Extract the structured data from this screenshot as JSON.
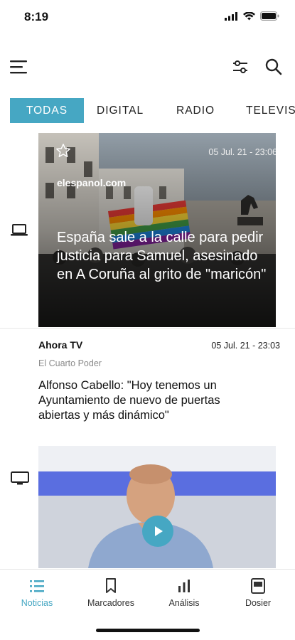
{
  "status_bar": {
    "time": "8:19"
  },
  "tabs": [
    {
      "label": "TODAS",
      "active": true
    },
    {
      "label": "DIGITAL",
      "active": false
    },
    {
      "label": "RADIO",
      "active": false
    },
    {
      "label": "TELEVIS",
      "active": false
    }
  ],
  "feed": [
    {
      "device": "laptop-icon",
      "date": "05 Jul. 21 - 23:06",
      "source": "elespanol.com",
      "headline": "España sale a la calle para pedir justicia para Samuel, asesinado en A Coruña al grito de \"maricón\""
    },
    {
      "device": "laptop-icon",
      "source": "Ahora TV",
      "date": "05 Jul. 21 - 23:03",
      "program": "El Cuarto Poder",
      "title": "Alfonso Cabello: \"Hoy tenemos un Ayuntamiento de nuevo de puertas abiertas y más dinámico\""
    },
    {
      "device": "tv-icon",
      "has_video": true
    }
  ],
  "bottom_nav": [
    {
      "label": "Noticias",
      "icon": "list-icon",
      "active": true
    },
    {
      "label": "Marcadores",
      "icon": "bookmark-icon",
      "active": false
    },
    {
      "label": "Análisis",
      "icon": "bar-chart-icon",
      "active": false
    },
    {
      "label": "Dosier",
      "icon": "dossier-icon",
      "active": false
    }
  ],
  "colors": {
    "accent": "#46a7c3",
    "text": "#111111",
    "muted": "#8a8a8a"
  }
}
